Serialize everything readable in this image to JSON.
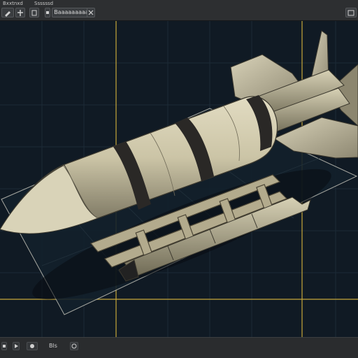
{
  "menubar": {
    "left_label": "Bxxtnxd",
    "right_label": "Ssssssd"
  },
  "toolbar": {
    "tab_label": "Baaaaaaaaa",
    "icons": [
      "pencil-icon",
      "pan-icon",
      "select-icon",
      "grid-icon",
      "close-icon",
      "window-icon"
    ]
  },
  "statusbar": {
    "text": "Bls",
    "icons": [
      "layers-icon",
      "play-icon",
      "record-icon",
      "settings-icon"
    ]
  },
  "colors": {
    "viewport_bg": "#101a24",
    "guide_line": "#c6a63a",
    "body": "#c9c3a8",
    "band": "#2a2826"
  }
}
